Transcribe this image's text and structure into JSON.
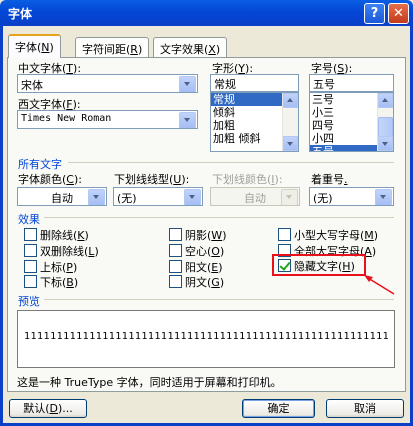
{
  "window": {
    "title": "字体",
    "help": "?",
    "close": "✕"
  },
  "tabs": [
    {
      "label": "字体",
      "key": "N"
    },
    {
      "label": "字符间距",
      "key": "R"
    },
    {
      "label": "文字效果",
      "key": "X"
    }
  ],
  "font": {
    "cn_label": "中文字体",
    "cn_key": "T",
    "cn_value": "宋体",
    "west_label": "西文字体",
    "west_key": "F",
    "west_value": "Times New Roman",
    "style_label": "字形",
    "style_key": "Y",
    "style_value": "常规",
    "style_items": [
      "常规",
      "倾斜",
      "加粗",
      "加粗 倾斜"
    ],
    "size_label": "字号",
    "size_key": "S",
    "size_value": "五号",
    "size_items": [
      "三号",
      "小三",
      "四号",
      "小四",
      "五号"
    ]
  },
  "all_text": {
    "section": "所有文字",
    "color_label": "字体颜色",
    "color_key": "C",
    "color_value": "自动",
    "underline_label": "下划线线型",
    "underline_key": "U",
    "underline_value": "(无)",
    "ucolor_label": "下划线颜色",
    "ucolor_key": "I",
    "ucolor_value": "自动",
    "emph_label": "着重号",
    "emph_value": "(无)"
  },
  "effects": {
    "section": "效果",
    "items": [
      {
        "label": "删除线",
        "key": "K",
        "checked": false
      },
      {
        "label": "双删除线",
        "key": "L",
        "checked": false
      },
      {
        "label": "上标",
        "key": "P",
        "checked": false
      },
      {
        "label": "下标",
        "key": "B",
        "checked": false
      },
      {
        "label": "阴影",
        "key": "W",
        "checked": false
      },
      {
        "label": "空心",
        "key": "O",
        "checked": false
      },
      {
        "label": "阳文",
        "key": "E",
        "checked": false
      },
      {
        "label": "阴文",
        "key": "G",
        "checked": false
      },
      {
        "label": "小型大写字母",
        "key": "M",
        "checked": false
      },
      {
        "label": "全部大写字母",
        "key": "A",
        "checked": false
      },
      {
        "label": "隐藏文字",
        "key": "H",
        "checked": true
      }
    ]
  },
  "preview": {
    "section": "预览",
    "sample": "1111111111111111111111111111111111111111111111111111111111111111111111111111111",
    "note": "这是一种 TrueType 字体，同时适用于屏幕和打印机。"
  },
  "buttons": {
    "default": "默认",
    "default_key": "D",
    "ok": "确定",
    "cancel": "取消"
  },
  "colors": {
    "accent_red": "#e8111b",
    "title_blue": "#0a5ee3"
  }
}
